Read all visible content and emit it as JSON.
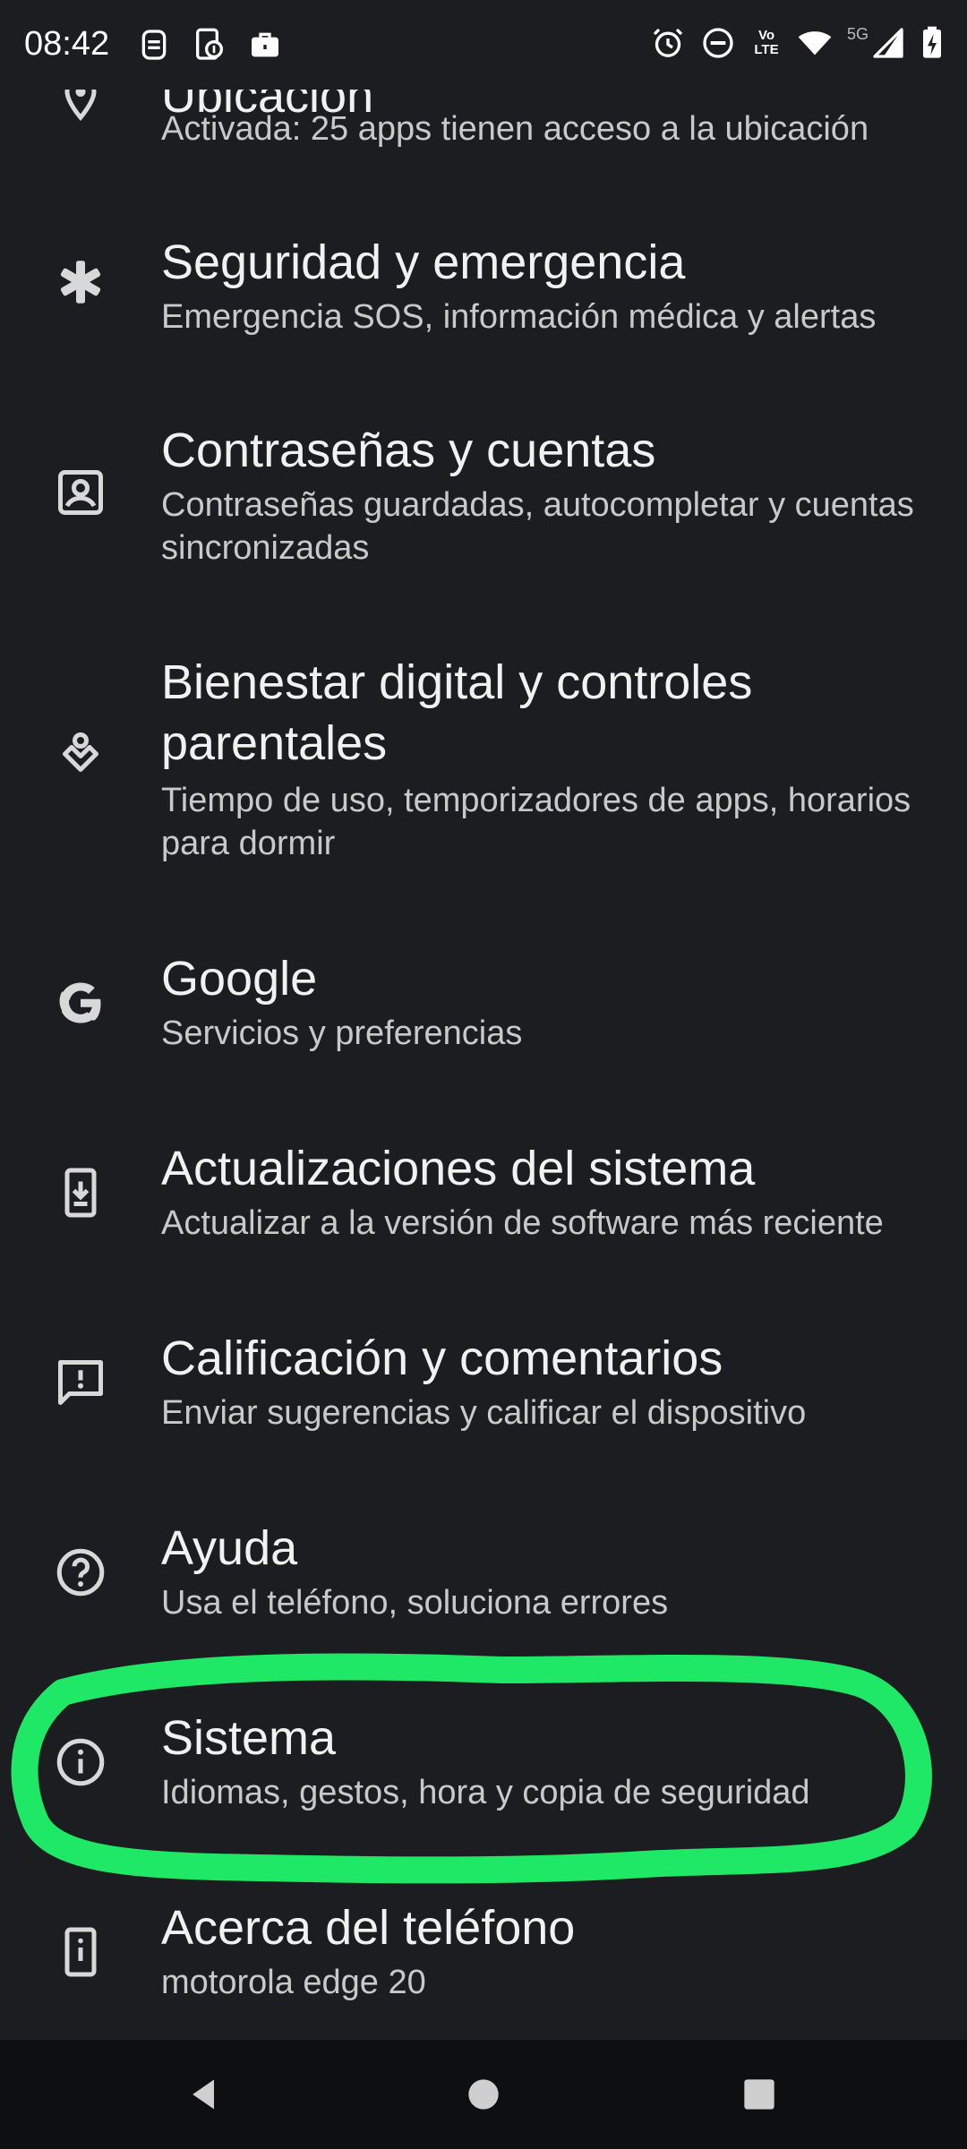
{
  "status_bar": {
    "time": "08:42",
    "left_icons": [
      "face-unlock-icon",
      "phone-debug-icon",
      "work-briefcase-icon"
    ],
    "right_icons": [
      "alarm-icon",
      "do-not-disturb-icon",
      "volte-icon",
      "wifi-icon",
      "signal-icon",
      "battery-charging-icon"
    ],
    "network_label": "5G",
    "volte_label": "Vo LTE"
  },
  "settings": {
    "items": [
      {
        "title": "Ubicación",
        "subtitle": "Activada: 25 apps tienen acceso a la ubicación",
        "icon": "location-pin-icon"
      },
      {
        "title": "Seguridad y emergencia",
        "subtitle": "Emergencia SOS, información médica y alertas",
        "icon": "asterisk-icon"
      },
      {
        "title": "Contraseñas y cuentas",
        "subtitle": "Contraseñas guardadas, autocompletar y cuentas sincronizadas",
        "icon": "account-box-icon"
      },
      {
        "title": "Bienestar digital y controles parentales",
        "subtitle": "Tiempo de uso, temporizadores de apps, horarios para dormir",
        "icon": "wellbeing-icon"
      },
      {
        "title": "Google",
        "subtitle": "Servicios y preferencias",
        "icon": "google-g-icon"
      },
      {
        "title": "Actualizaciones del sistema",
        "subtitle": "Actualizar a la versión de software más reciente",
        "icon": "system-update-icon"
      },
      {
        "title": "Calificación y comentarios",
        "subtitle": "Enviar sugerencias y calificar el dispositivo",
        "icon": "feedback-icon"
      },
      {
        "title": "Ayuda",
        "subtitle": "Usa el teléfono, soluciona errores",
        "icon": "help-circle-icon"
      },
      {
        "title": "Sistema",
        "subtitle": "Idiomas, gestos, hora y copia de seguridad",
        "icon": "info-circle-icon"
      },
      {
        "title": "Acerca del teléfono",
        "subtitle": "motorola edge 20",
        "icon": "phone-info-icon"
      }
    ]
  },
  "annotation": {
    "color": "#1ee866",
    "target": "Sistema"
  },
  "nav_bar": {
    "buttons": [
      "back-icon",
      "home-icon",
      "recents-icon"
    ]
  },
  "colors": {
    "background": "#1b1d20",
    "title": "#f1f1f1",
    "subtitle": "#c9c9c9",
    "icon": "#d8d8d8",
    "highlight": "#1ee866"
  }
}
